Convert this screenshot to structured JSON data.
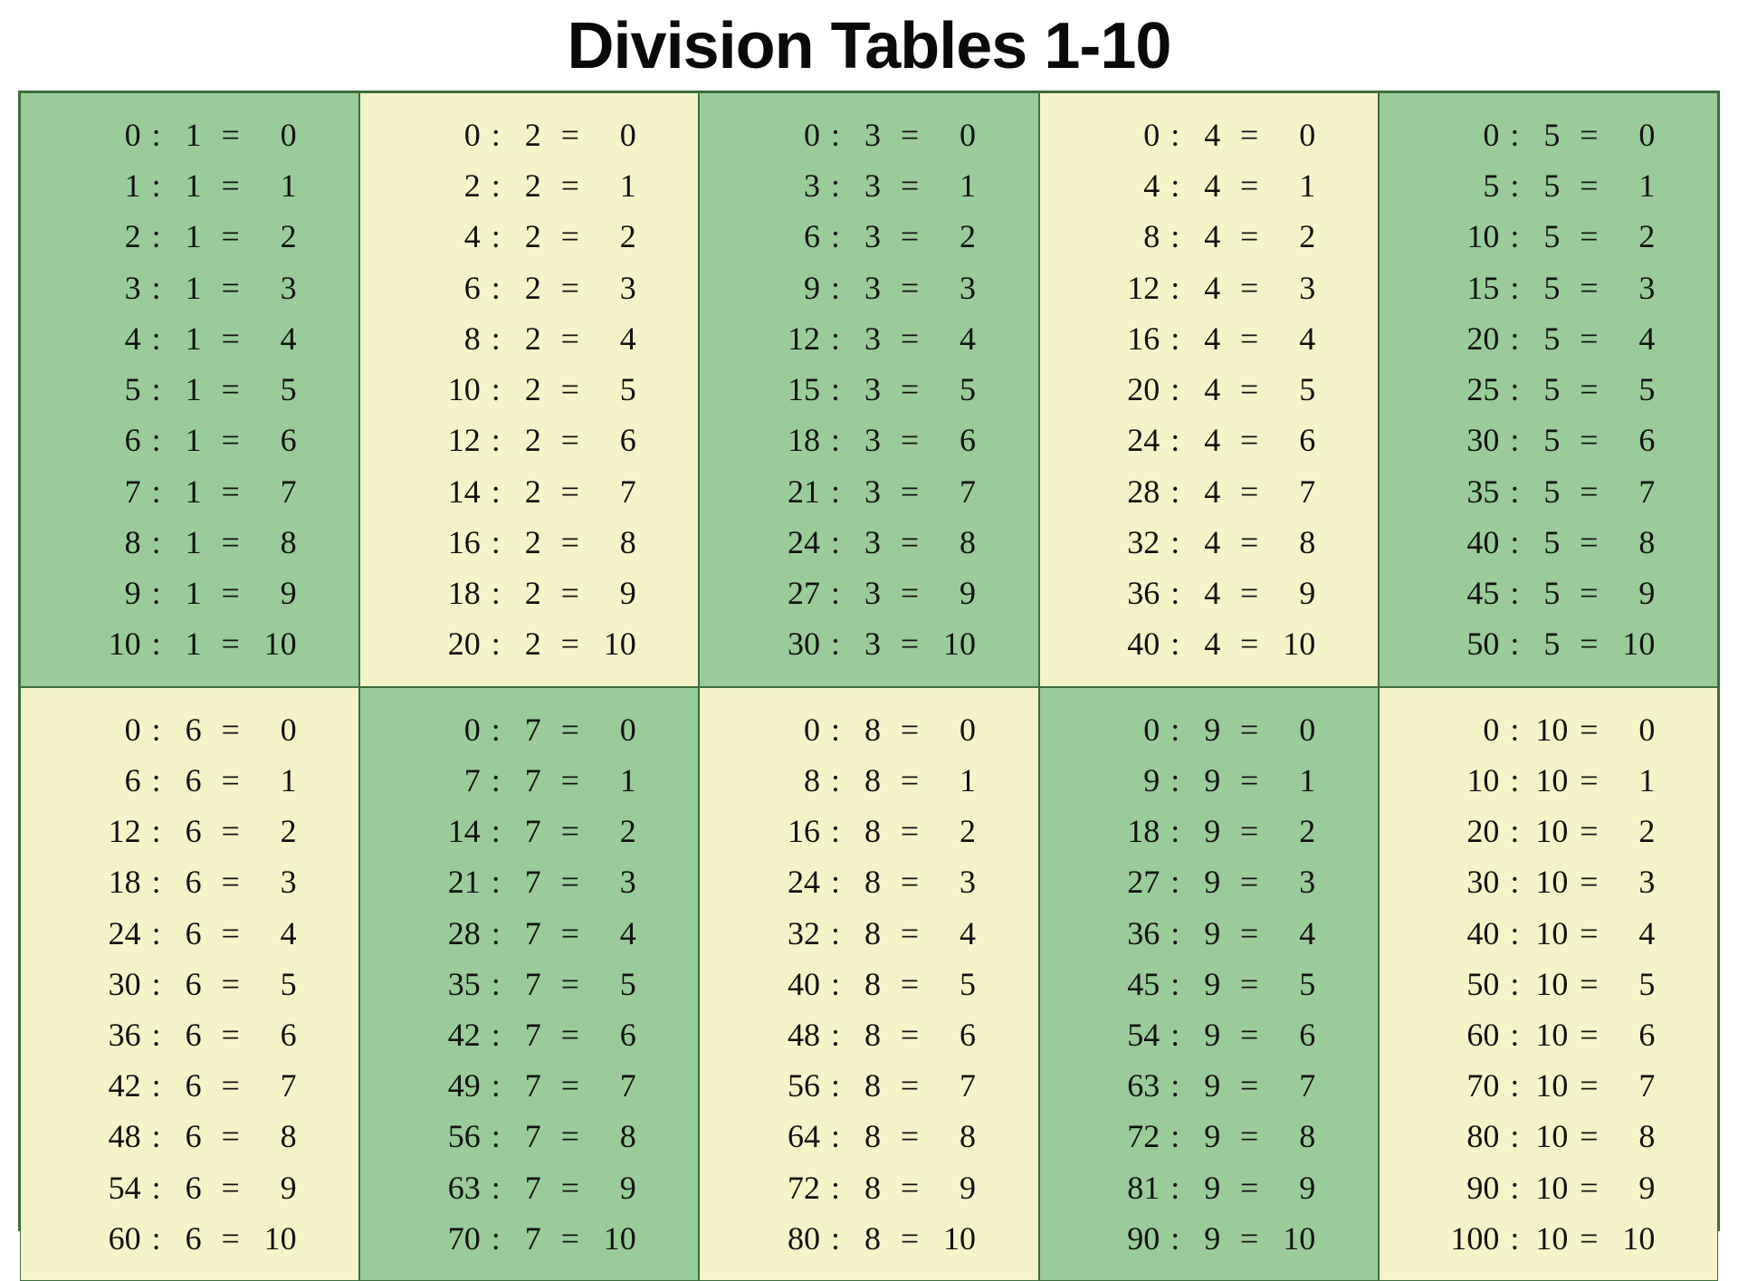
{
  "title": "Division Tables 1-10",
  "chart_data": {
    "type": "table",
    "title": "Division Tables 1-10",
    "divisors": [
      1,
      2,
      3,
      4,
      5,
      6,
      7,
      8,
      9,
      10
    ],
    "quotients": [
      0,
      1,
      2,
      3,
      4,
      5,
      6,
      7,
      8,
      9,
      10
    ]
  },
  "colors": {
    "green": "#99cc99",
    "yellow": "#f4f4c8",
    "border": "#3c6e3c"
  },
  "grid": [
    [
      {
        "bg": "green",
        "rows": [
          {
            "a": 0,
            "op": ":",
            "b": 1,
            "eq": "=",
            "c": 0
          },
          {
            "a": 1,
            "op": ":",
            "b": 1,
            "eq": "=",
            "c": 1
          },
          {
            "a": 2,
            "op": ":",
            "b": 1,
            "eq": "=",
            "c": 2
          },
          {
            "a": 3,
            "op": ":",
            "b": 1,
            "eq": "=",
            "c": 3
          },
          {
            "a": 4,
            "op": ":",
            "b": 1,
            "eq": "=",
            "c": 4
          },
          {
            "a": 5,
            "op": ":",
            "b": 1,
            "eq": "=",
            "c": 5
          },
          {
            "a": 6,
            "op": ":",
            "b": 1,
            "eq": "=",
            "c": 6
          },
          {
            "a": 7,
            "op": ":",
            "b": 1,
            "eq": "=",
            "c": 7
          },
          {
            "a": 8,
            "op": ":",
            "b": 1,
            "eq": "=",
            "c": 8
          },
          {
            "a": 9,
            "op": ":",
            "b": 1,
            "eq": "=",
            "c": 9
          },
          {
            "a": 10,
            "op": ":",
            "b": 1,
            "eq": "=",
            "c": 10
          }
        ]
      },
      {
        "bg": "yellow",
        "rows": [
          {
            "a": 0,
            "op": ":",
            "b": 2,
            "eq": "=",
            "c": 0
          },
          {
            "a": 2,
            "op": ":",
            "b": 2,
            "eq": "=",
            "c": 1
          },
          {
            "a": 4,
            "op": ":",
            "b": 2,
            "eq": "=",
            "c": 2
          },
          {
            "a": 6,
            "op": ":",
            "b": 2,
            "eq": "=",
            "c": 3
          },
          {
            "a": 8,
            "op": ":",
            "b": 2,
            "eq": "=",
            "c": 4
          },
          {
            "a": 10,
            "op": ":",
            "b": 2,
            "eq": "=",
            "c": 5
          },
          {
            "a": 12,
            "op": ":",
            "b": 2,
            "eq": "=",
            "c": 6
          },
          {
            "a": 14,
            "op": ":",
            "b": 2,
            "eq": "=",
            "c": 7
          },
          {
            "a": 16,
            "op": ":",
            "b": 2,
            "eq": "=",
            "c": 8
          },
          {
            "a": 18,
            "op": ":",
            "b": 2,
            "eq": "=",
            "c": 9
          },
          {
            "a": 20,
            "op": ":",
            "b": 2,
            "eq": "=",
            "c": 10
          }
        ]
      },
      {
        "bg": "green",
        "rows": [
          {
            "a": 0,
            "op": ":",
            "b": 3,
            "eq": "=",
            "c": 0
          },
          {
            "a": 3,
            "op": ":",
            "b": 3,
            "eq": "=",
            "c": 1
          },
          {
            "a": 6,
            "op": ":",
            "b": 3,
            "eq": "=",
            "c": 2
          },
          {
            "a": 9,
            "op": ":",
            "b": 3,
            "eq": "=",
            "c": 3
          },
          {
            "a": 12,
            "op": ":",
            "b": 3,
            "eq": "=",
            "c": 4
          },
          {
            "a": 15,
            "op": ":",
            "b": 3,
            "eq": "=",
            "c": 5
          },
          {
            "a": 18,
            "op": ":",
            "b": 3,
            "eq": "=",
            "c": 6
          },
          {
            "a": 21,
            "op": ":",
            "b": 3,
            "eq": "=",
            "c": 7
          },
          {
            "a": 24,
            "op": ":",
            "b": 3,
            "eq": "=",
            "c": 8
          },
          {
            "a": 27,
            "op": ":",
            "b": 3,
            "eq": "=",
            "c": 9
          },
          {
            "a": 30,
            "op": ":",
            "b": 3,
            "eq": "=",
            "c": 10
          }
        ]
      },
      {
        "bg": "yellow",
        "rows": [
          {
            "a": 0,
            "op": ":",
            "b": 4,
            "eq": "=",
            "c": 0
          },
          {
            "a": 4,
            "op": ":",
            "b": 4,
            "eq": "=",
            "c": 1
          },
          {
            "a": 8,
            "op": ":",
            "b": 4,
            "eq": "=",
            "c": 2
          },
          {
            "a": 12,
            "op": ":",
            "b": 4,
            "eq": "=",
            "c": 3
          },
          {
            "a": 16,
            "op": ":",
            "b": 4,
            "eq": "=",
            "c": 4
          },
          {
            "a": 20,
            "op": ":",
            "b": 4,
            "eq": "=",
            "c": 5
          },
          {
            "a": 24,
            "op": ":",
            "b": 4,
            "eq": "=",
            "c": 6
          },
          {
            "a": 28,
            "op": ":",
            "b": 4,
            "eq": "=",
            "c": 7
          },
          {
            "a": 32,
            "op": ":",
            "b": 4,
            "eq": "=",
            "c": 8
          },
          {
            "a": 36,
            "op": ":",
            "b": 4,
            "eq": "=",
            "c": 9
          },
          {
            "a": 40,
            "op": ":",
            "b": 4,
            "eq": "=",
            "c": 10
          }
        ]
      },
      {
        "bg": "green",
        "rows": [
          {
            "a": 0,
            "op": ":",
            "b": 5,
            "eq": "=",
            "c": 0
          },
          {
            "a": 5,
            "op": ":",
            "b": 5,
            "eq": "=",
            "c": 1
          },
          {
            "a": 10,
            "op": ":",
            "b": 5,
            "eq": "=",
            "c": 2
          },
          {
            "a": 15,
            "op": ":",
            "b": 5,
            "eq": "=",
            "c": 3
          },
          {
            "a": 20,
            "op": ":",
            "b": 5,
            "eq": "=",
            "c": 4
          },
          {
            "a": 25,
            "op": ":",
            "b": 5,
            "eq": "=",
            "c": 5
          },
          {
            "a": 30,
            "op": ":",
            "b": 5,
            "eq": "=",
            "c": 6
          },
          {
            "a": 35,
            "op": ":",
            "b": 5,
            "eq": "=",
            "c": 7
          },
          {
            "a": 40,
            "op": ":",
            "b": 5,
            "eq": "=",
            "c": 8
          },
          {
            "a": 45,
            "op": ":",
            "b": 5,
            "eq": "=",
            "c": 9
          },
          {
            "a": 50,
            "op": ":",
            "b": 5,
            "eq": "=",
            "c": 10
          }
        ]
      }
    ],
    [
      {
        "bg": "yellow",
        "rows": [
          {
            "a": 0,
            "op": ":",
            "b": 6,
            "eq": "=",
            "c": 0
          },
          {
            "a": 6,
            "op": ":",
            "b": 6,
            "eq": "=",
            "c": 1
          },
          {
            "a": 12,
            "op": ":",
            "b": 6,
            "eq": "=",
            "c": 2
          },
          {
            "a": 18,
            "op": ":",
            "b": 6,
            "eq": "=",
            "c": 3
          },
          {
            "a": 24,
            "op": ":",
            "b": 6,
            "eq": "=",
            "c": 4
          },
          {
            "a": 30,
            "op": ":",
            "b": 6,
            "eq": "=",
            "c": 5
          },
          {
            "a": 36,
            "op": ":",
            "b": 6,
            "eq": "=",
            "c": 6
          },
          {
            "a": 42,
            "op": ":",
            "b": 6,
            "eq": "=",
            "c": 7
          },
          {
            "a": 48,
            "op": ":",
            "b": 6,
            "eq": "=",
            "c": 8
          },
          {
            "a": 54,
            "op": ":",
            "b": 6,
            "eq": "=",
            "c": 9
          },
          {
            "a": 60,
            "op": ":",
            "b": 6,
            "eq": "=",
            "c": 10
          }
        ]
      },
      {
        "bg": "green",
        "rows": [
          {
            "a": 0,
            "op": ":",
            "b": 7,
            "eq": "=",
            "c": 0
          },
          {
            "a": 7,
            "op": ":",
            "b": 7,
            "eq": "=",
            "c": 1
          },
          {
            "a": 14,
            "op": ":",
            "b": 7,
            "eq": "=",
            "c": 2
          },
          {
            "a": 21,
            "op": ":",
            "b": 7,
            "eq": "=",
            "c": 3
          },
          {
            "a": 28,
            "op": ":",
            "b": 7,
            "eq": "=",
            "c": 4
          },
          {
            "a": 35,
            "op": ":",
            "b": 7,
            "eq": "=",
            "c": 5
          },
          {
            "a": 42,
            "op": ":",
            "b": 7,
            "eq": "=",
            "c": 6
          },
          {
            "a": 49,
            "op": ":",
            "b": 7,
            "eq": "=",
            "c": 7
          },
          {
            "a": 56,
            "op": ":",
            "b": 7,
            "eq": "=",
            "c": 8
          },
          {
            "a": 63,
            "op": ":",
            "b": 7,
            "eq": "=",
            "c": 9
          },
          {
            "a": 70,
            "op": ":",
            "b": 7,
            "eq": "=",
            "c": 10
          }
        ]
      },
      {
        "bg": "yellow",
        "rows": [
          {
            "a": 0,
            "op": ":",
            "b": 8,
            "eq": "=",
            "c": 0
          },
          {
            "a": 8,
            "op": ":",
            "b": 8,
            "eq": "=",
            "c": 1
          },
          {
            "a": 16,
            "op": ":",
            "b": 8,
            "eq": "=",
            "c": 2
          },
          {
            "a": 24,
            "op": ":",
            "b": 8,
            "eq": "=",
            "c": 3
          },
          {
            "a": 32,
            "op": ":",
            "b": 8,
            "eq": "=",
            "c": 4
          },
          {
            "a": 40,
            "op": ":",
            "b": 8,
            "eq": "=",
            "c": 5
          },
          {
            "a": 48,
            "op": ":",
            "b": 8,
            "eq": "=",
            "c": 6
          },
          {
            "a": 56,
            "op": ":",
            "b": 8,
            "eq": "=",
            "c": 7
          },
          {
            "a": 64,
            "op": ":",
            "b": 8,
            "eq": "=",
            "c": 8
          },
          {
            "a": 72,
            "op": ":",
            "b": 8,
            "eq": "=",
            "c": 9
          },
          {
            "a": 80,
            "op": ":",
            "b": 8,
            "eq": "=",
            "c": 10
          }
        ]
      },
      {
        "bg": "green",
        "rows": [
          {
            "a": 0,
            "op": ":",
            "b": 9,
            "eq": "=",
            "c": 0
          },
          {
            "a": 9,
            "op": ":",
            "b": 9,
            "eq": "=",
            "c": 1
          },
          {
            "a": 18,
            "op": ":",
            "b": 9,
            "eq": "=",
            "c": 2
          },
          {
            "a": 27,
            "op": ":",
            "b": 9,
            "eq": "=",
            "c": 3
          },
          {
            "a": 36,
            "op": ":",
            "b": 9,
            "eq": "=",
            "c": 4
          },
          {
            "a": 45,
            "op": ":",
            "b": 9,
            "eq": "=",
            "c": 5
          },
          {
            "a": 54,
            "op": ":",
            "b": 9,
            "eq": "=",
            "c": 6
          },
          {
            "a": 63,
            "op": ":",
            "b": 9,
            "eq": "=",
            "c": 7
          },
          {
            "a": 72,
            "op": ":",
            "b": 9,
            "eq": "=",
            "c": 8
          },
          {
            "a": 81,
            "op": ":",
            "b": 9,
            "eq": "=",
            "c": 9
          },
          {
            "a": 90,
            "op": ":",
            "b": 9,
            "eq": "=",
            "c": 10
          }
        ]
      },
      {
        "bg": "yellow",
        "rows": [
          {
            "a": 0,
            "op": ":",
            "b": 10,
            "eq": "=",
            "c": 0
          },
          {
            "a": 10,
            "op": ":",
            "b": 10,
            "eq": "=",
            "c": 1
          },
          {
            "a": 20,
            "op": ":",
            "b": 10,
            "eq": "=",
            "c": 2
          },
          {
            "a": 30,
            "op": ":",
            "b": 10,
            "eq": "=",
            "c": 3
          },
          {
            "a": 40,
            "op": ":",
            "b": 10,
            "eq": "=",
            "c": 4
          },
          {
            "a": 50,
            "op": ":",
            "b": 10,
            "eq": "=",
            "c": 5
          },
          {
            "a": 60,
            "op": ":",
            "b": 10,
            "eq": "=",
            "c": 6
          },
          {
            "a": 70,
            "op": ":",
            "b": 10,
            "eq": "=",
            "c": 7
          },
          {
            "a": 80,
            "op": ":",
            "b": 10,
            "eq": "=",
            "c": 8
          },
          {
            "a": 90,
            "op": ":",
            "b": 10,
            "eq": "=",
            "c": 9
          },
          {
            "a": 100,
            "op": ":",
            "b": 10,
            "eq": "=",
            "c": 10
          }
        ]
      }
    ]
  ]
}
